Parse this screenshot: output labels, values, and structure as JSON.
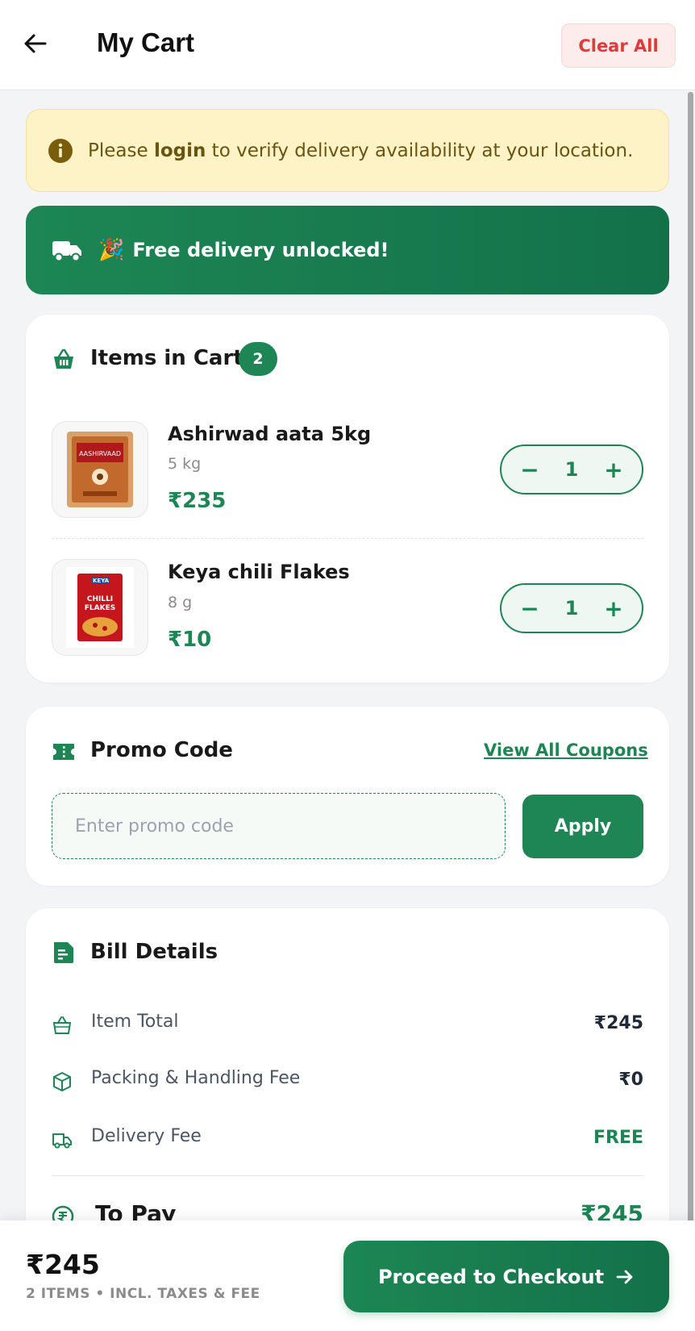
{
  "header": {
    "title": "My Cart",
    "clear_label": "Clear All"
  },
  "notice": {
    "before": "Please ",
    "link": "login",
    "after": " to verify delivery availability at your location."
  },
  "banner": {
    "text": "Free delivery unlocked!",
    "emoji": "🎉"
  },
  "cart": {
    "title": "Items in Cart",
    "count": "2",
    "items": [
      {
        "name": "Ashirwad aata 5kg",
        "qty": "5 kg",
        "price": "₹235",
        "quantity": "1",
        "pack_brand": "AASHIRVAAD"
      },
      {
        "name": "Keya chili Flakes",
        "qty": "8 g",
        "price": "₹10",
        "quantity": "1",
        "pack_brand": "KEYA",
        "pack_text_1": "CHILLI",
        "pack_text_2": "FLAKES"
      }
    ]
  },
  "promo": {
    "title": "Promo Code",
    "view_all": "View All Coupons",
    "placeholder": "Enter promo code",
    "apply_label": "Apply"
  },
  "bill": {
    "title": "Bill Details",
    "rows": [
      {
        "label": "Item Total",
        "value": "₹245",
        "icon": "basket-icon"
      },
      {
        "label": "Packing & Handling Fee",
        "value": "₹0",
        "icon": "box-icon"
      },
      {
        "label": "Delivery Fee",
        "value": "FREE",
        "icon": "truck-icon"
      }
    ],
    "to_pay_label": "To Pay",
    "to_pay_value": "₹245"
  },
  "footer": {
    "total": "₹245",
    "subtext": "2 ITEMS • INCL. TAXES & FEE",
    "checkout_label": "Proceed to Checkout"
  },
  "colors": {
    "accent": "#1d8654",
    "danger": "#e03a3a",
    "notice_bg": "#fdf3c7"
  }
}
